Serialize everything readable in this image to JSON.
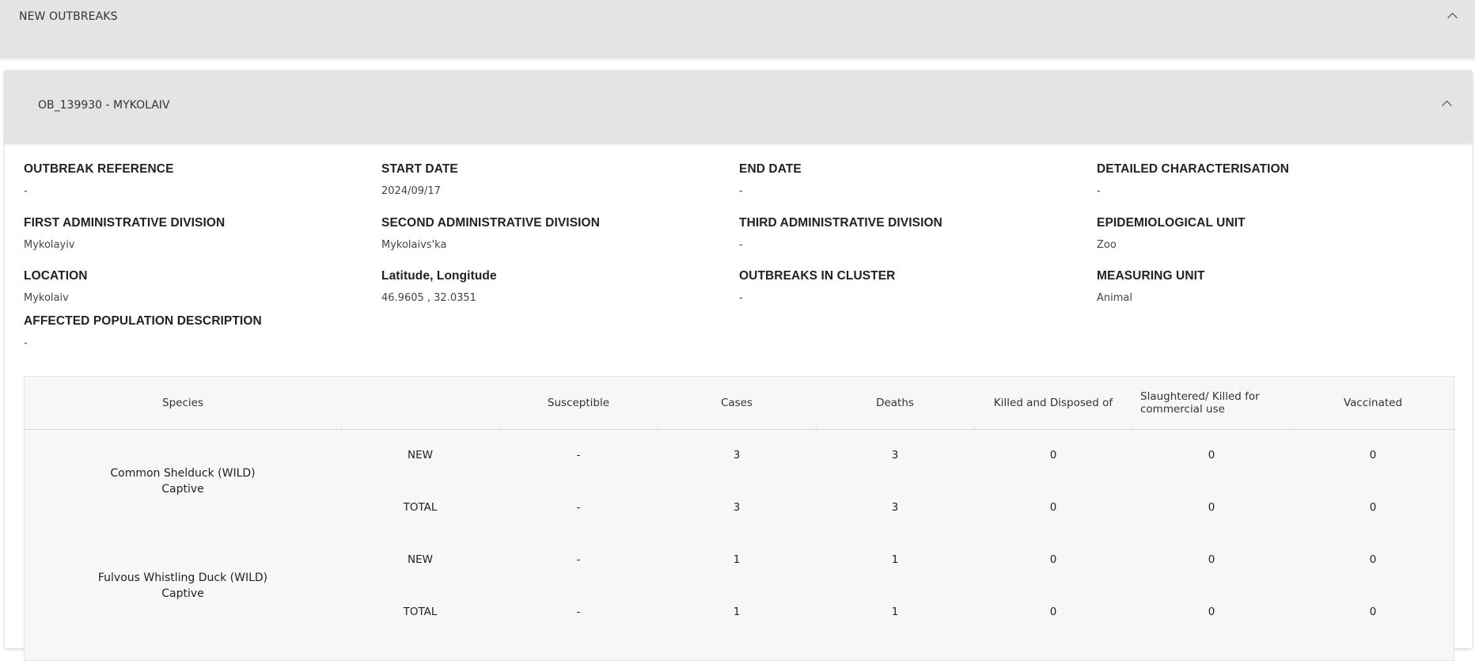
{
  "top_panel": {
    "title": "NEW OUTBREAKS"
  },
  "outbreak": {
    "title": "OB_139930 - MYKOLAIV",
    "fields": [
      {
        "label": "OUTBREAK REFERENCE",
        "value": "-"
      },
      {
        "label": "START DATE",
        "value": "2024/09/17"
      },
      {
        "label": "END DATE",
        "value": "-"
      },
      {
        "label": "DETAILED CHARACTERISATION",
        "value": "-"
      },
      {
        "label": "FIRST ADMINISTRATIVE DIVISION",
        "value": "Mykolayiv"
      },
      {
        "label": "SECOND ADMINISTRATIVE DIVISION",
        "value": "Mykolaivs'ka"
      },
      {
        "label": "THIRD ADMINISTRATIVE DIVISION",
        "value": "-"
      },
      {
        "label": "EPIDEMIOLOGICAL UNIT",
        "value": "Zoo"
      },
      {
        "label": "LOCATION",
        "value": "Mykolaiv"
      },
      {
        "label": "Latitude, Longitude",
        "value": "46.9605 , 32.0351"
      },
      {
        "label": "OUTBREAKS IN CLUSTER",
        "value": "-"
      },
      {
        "label": "MEASURING UNIT",
        "value": "Animal"
      },
      {
        "label": "AFFECTED POPULATION DESCRIPTION",
        "value": "-"
      }
    ]
  },
  "table": {
    "headers": [
      "Species",
      "",
      "Susceptible",
      "Cases",
      "Deaths",
      "Killed and Disposed of",
      "Slaughtered/ Killed for commercial use",
      "Vaccinated"
    ],
    "groups": [
      {
        "species": "Common Shelduck (WILD)",
        "subtitle": "Captive",
        "rows": [
          [
            "NEW",
            "-",
            "3",
            "3",
            "0",
            "0",
            "0"
          ],
          [
            "TOTAL",
            "-",
            "3",
            "3",
            "0",
            "0",
            "0"
          ]
        ]
      },
      {
        "species": "Fulvous Whistling Duck (WILD)",
        "subtitle": "Captive",
        "rows": [
          [
            "NEW",
            "-",
            "1",
            "1",
            "0",
            "0",
            "0"
          ],
          [
            "TOTAL",
            "-",
            "1",
            "1",
            "0",
            "0",
            "0"
          ]
        ]
      }
    ]
  }
}
